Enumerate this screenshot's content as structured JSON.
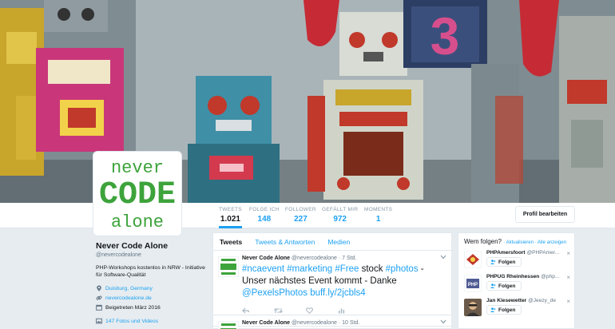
{
  "profile_nav": {
    "stats": [
      {
        "label": "TWEETS",
        "value": "1.021"
      },
      {
        "label": "FOLGE ICH",
        "value": "148"
      },
      {
        "label": "FOLLOWER",
        "value": "227"
      },
      {
        "label": "GEFÄLLT MIR",
        "value": "972"
      },
      {
        "label": "MOMENTS",
        "value": "1"
      }
    ],
    "edit_button": "Profil bearbeiten"
  },
  "profile": {
    "logo_lines": [
      "never",
      "CODE",
      "alone"
    ],
    "name": "Never Code Alone",
    "handle": "@nevercodealone",
    "bio": "PHP-Workshops kostenlos in NRW - Initiative für Software-Qualität",
    "location": "Duisburg, Germany",
    "website": "nevercodealone.de",
    "joined": "Beigetreten März 2016",
    "photos": "147 Fotos und Videos"
  },
  "timeline": {
    "tabs": [
      "Tweets",
      "Tweets & Antworten",
      "Medien"
    ],
    "tweets": [
      {
        "author": "Never Code Alone",
        "meta": "@nevercodealone · 7 Std.",
        "body_parts": [
          {
            "text": "#ncaevent",
            "type": "tag"
          },
          {
            "text": " ",
            "type": "plain"
          },
          {
            "text": "#marketing",
            "type": "tag"
          },
          {
            "text": " ",
            "type": "plain"
          },
          {
            "text": "#Free",
            "type": "tag"
          },
          {
            "text": " stock ",
            "type": "plain"
          },
          {
            "text": "#photos",
            "type": "tag"
          },
          {
            "text": " - Unser nächstes Event kommt - Danke ",
            "type": "plain"
          },
          {
            "text": "@PexelsPhotos",
            "type": "tag"
          },
          {
            "text": " ",
            "type": "plain"
          },
          {
            "text": "buff.ly/2jcbls4",
            "type": "tag"
          }
        ]
      },
      {
        "author": "Never Code Alone",
        "meta": "@nevercodealone · 10 Std."
      }
    ]
  },
  "who_to_follow": {
    "title": "Wem folgen?",
    "links": "· Aktualisieren · Alle anzeigen",
    "suggestions": [
      {
        "name": "PHPAmersfoort",
        "handle": "@PHPAmer...",
        "button": "Folgen",
        "close": "×"
      },
      {
        "name": "PHPUG Rheinhessen",
        "handle": "@php...",
        "button": "Folgen",
        "close": "×"
      },
      {
        "name": "Jan Kiesewetter",
        "handle": "@Jeezy_de",
        "button": "Folgen",
        "close": "×"
      }
    ]
  },
  "colors": {
    "accent": "#1da1f2",
    "logo_green": "#3da33b",
    "background": "#e6ecf0"
  }
}
